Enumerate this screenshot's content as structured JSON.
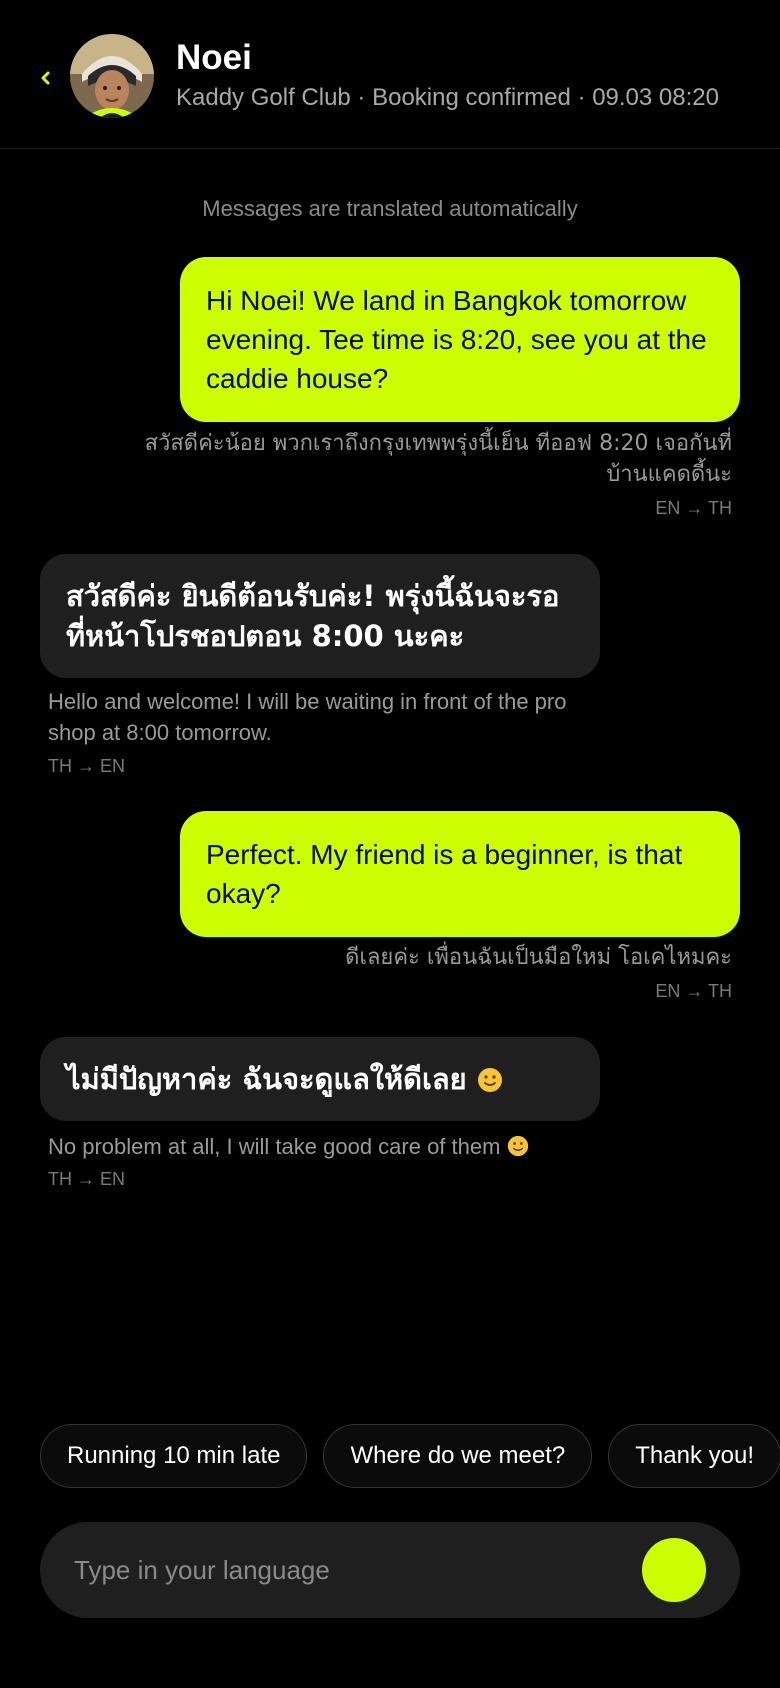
{
  "header": {
    "name": "Noei",
    "subtitle": "Kaddy Golf Club · Booking confirmed · 09.03 08:20",
    "back_icon": "chevron-left-icon",
    "accent_color": "#ccff00"
  },
  "notice": "Messages are translated automatically",
  "messages": [
    {
      "from": "me",
      "text": "Hi Noei! We land in Bangkok tomorrow evening. Tee time is 8:20, see you at the caddie house?",
      "translation": "สวัสดีค่ะน้อย พวกเราถึงกรุงเทพพรุ่งนี้เย็น ทีออฟ 8:20 เจอกันที่บ้านแคดดี้นะ",
      "direction": "EN → TH"
    },
    {
      "from": "caddie",
      "text": "สวัสดีค่ะ ยินดีต้อนรับค่ะ! พรุ่งนี้ฉันจะรอที่หน้าโปรชอปตอน 8:00 นะคะ",
      "translation": "Hello and welcome! I will be waiting in front of the pro shop at 8:00 tomorrow.",
      "direction": "TH → EN"
    },
    {
      "from": "me",
      "text": "Perfect. My friend is a beginner, is that okay?",
      "translation": "ดีเลยค่ะ เพื่อนฉันเป็นมือใหม่ โอเคไหมคะ",
      "direction": "EN → TH"
    },
    {
      "from": "caddie",
      "text": "ไม่มีปัญหาค่ะ ฉันจะดูแลให้ดีเลย",
      "emoji": "slightly-smiling-face-icon",
      "translation": "No problem at all, I will take good care of them",
      "direction": "TH → EN"
    }
  ],
  "quick_replies": [
    "Running 10 min late",
    "Where do we meet?",
    "Thank you!"
  ],
  "composer": {
    "placeholder": "Type in your language",
    "send_icon": "send-icon"
  }
}
